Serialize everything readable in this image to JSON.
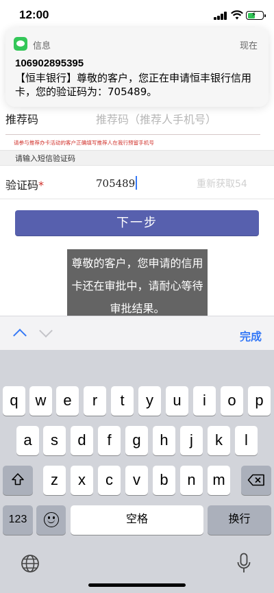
{
  "status_bar": {
    "time": "12:00"
  },
  "notification": {
    "app_name": "信息",
    "time": "现在",
    "sender": "106902895395",
    "body": "【恒丰银行】尊敬的客户，您正在申请恒丰银行信用卡，您的验证码为：705489。"
  },
  "form": {
    "referrer_label": "推荐码",
    "referrer_placeholder": "推荐码（推荐人手机号）",
    "referrer_tip": "请参与推荐办卡活动的客户正确填写推荐人在我行预留手机号",
    "sms_section_title": "请输入短信验证码",
    "code_label": "验证码",
    "code_required_mark": "*",
    "code_value": "705489",
    "resend_label": "重新获取54",
    "next_label": "下一步"
  },
  "toast": {
    "message": "尊敬的客户，您申请的信用卡还在审批中，请耐心等待审批结果。"
  },
  "accessory": {
    "done_label": "完成"
  },
  "keyboard": {
    "row1": [
      "q",
      "w",
      "e",
      "r",
      "t",
      "y",
      "u",
      "i",
      "o",
      "p"
    ],
    "row2": [
      "a",
      "s",
      "d",
      "f",
      "g",
      "h",
      "j",
      "k",
      "l"
    ],
    "row3": [
      "z",
      "x",
      "c",
      "v",
      "b",
      "n",
      "m"
    ],
    "numbers_label": "123",
    "space_label": "空格",
    "return_label": "换行"
  },
  "colors": {
    "accent": "#3478f6",
    "button": "#5760ae",
    "required": "#d0302a"
  }
}
